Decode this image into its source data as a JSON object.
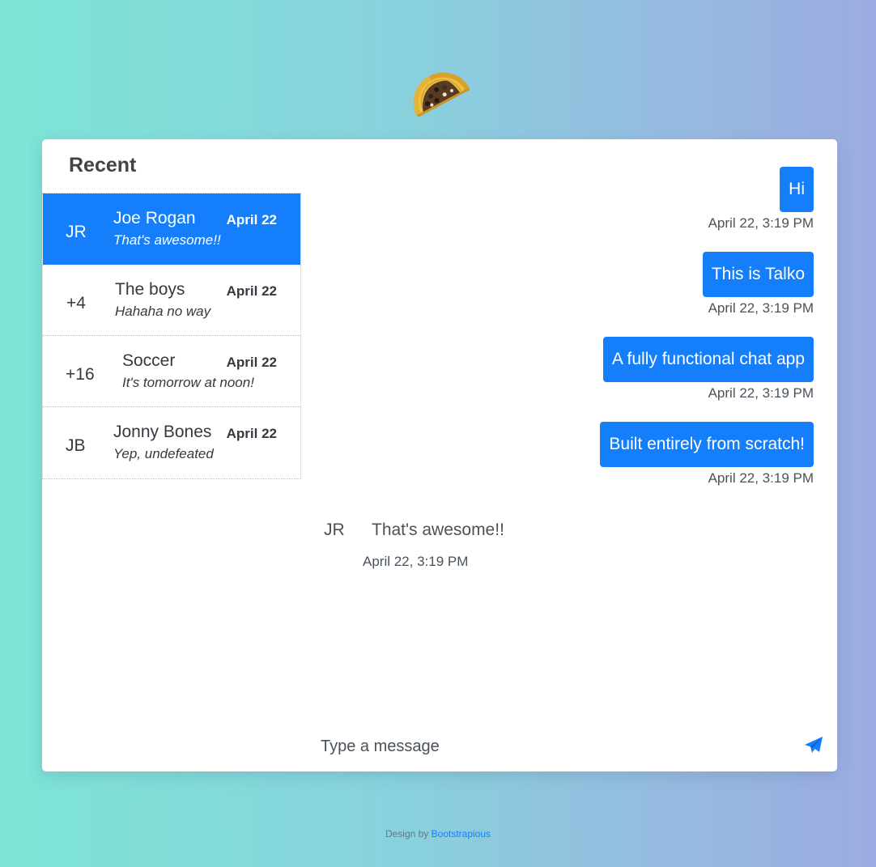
{
  "logo": {
    "icon": "taco-icon"
  },
  "sidebar": {
    "title": "Recent",
    "conversations": [
      {
        "avatar": "JR",
        "name": "Joe Rogan",
        "date": "April 22",
        "preview": "That's awesome!!",
        "active": true
      },
      {
        "avatar": "+4",
        "name": "The boys",
        "date": "April 22",
        "preview": "Hahaha no way",
        "active": false
      },
      {
        "avatar": "+16",
        "name": "Soccer",
        "date": "April 22",
        "preview": "It's tomorrow at noon!",
        "active": false
      },
      {
        "avatar": "JB",
        "name": "Jonny Bones",
        "date": "April 22",
        "preview": "Yep, undefeated",
        "active": false
      }
    ]
  },
  "chat": {
    "outgoing": [
      {
        "text": "Hi",
        "time": "April 22, 3:19 PM"
      },
      {
        "text": "This is Talko",
        "time": "April 22, 3:19 PM"
      },
      {
        "text": "A fully functional chat app",
        "time": "April 22, 3:19 PM"
      },
      {
        "text": "Built entirely from scratch!",
        "time": "April 22, 3:19 PM"
      }
    ],
    "incoming": {
      "avatar": "JR",
      "text": "That's awesome!!",
      "time": "April 22, 3:19 PM"
    }
  },
  "composer": {
    "placeholder": "Type a message",
    "value": "",
    "send_icon": "paper-plane-icon"
  },
  "footer": {
    "prefix": "Design by",
    "link": "Bootstrapious"
  },
  "colors": {
    "accent": "#157ffb",
    "text": "#343a40"
  }
}
